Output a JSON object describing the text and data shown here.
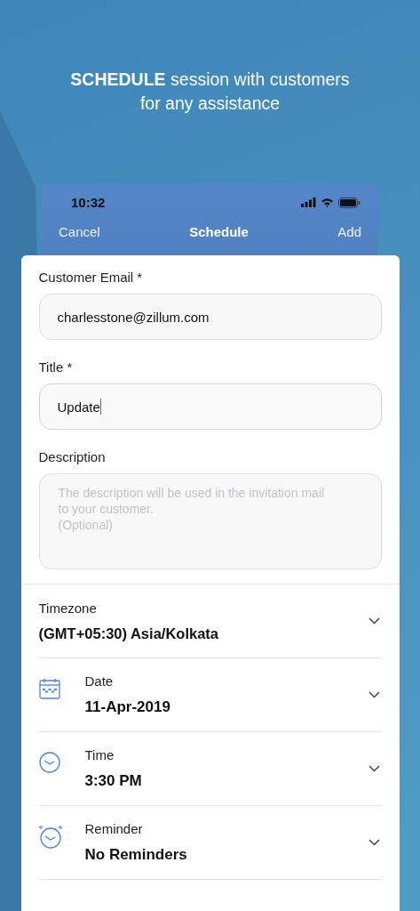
{
  "headline": "**SCHEDULE** session with customers for any assistance",
  "status_bar": {
    "time": "10:32"
  },
  "nav_bar": {
    "left": "Cancel",
    "title": "Schedule",
    "right": "Add"
  },
  "fields": [
    {
      "kind": "input",
      "label": "Customer Email *",
      "value": "charlesstone@zillum.com",
      "focused": false
    },
    {
      "kind": "input",
      "label": "Title *",
      "value": "Update",
      "focused": true
    },
    {
      "kind": "textarea",
      "label": "Description",
      "placeholder": "The description will be used in the invitation mail\nto your customer.\n(Optional)"
    }
  ],
  "pickers": [
    {
      "kind": "timezone",
      "label": "Timezone",
      "value": "(GMT+05:30) Asia/Kolkata"
    },
    {
      "kind": "date",
      "label": "Date",
      "value": "11-Apr-2019"
    },
    {
      "kind": "time",
      "label": "Time",
      "value": "3:30 PM"
    },
    {
      "kind": "reminder",
      "label": "Reminder",
      "value": "No Reminders"
    }
  ]
}
